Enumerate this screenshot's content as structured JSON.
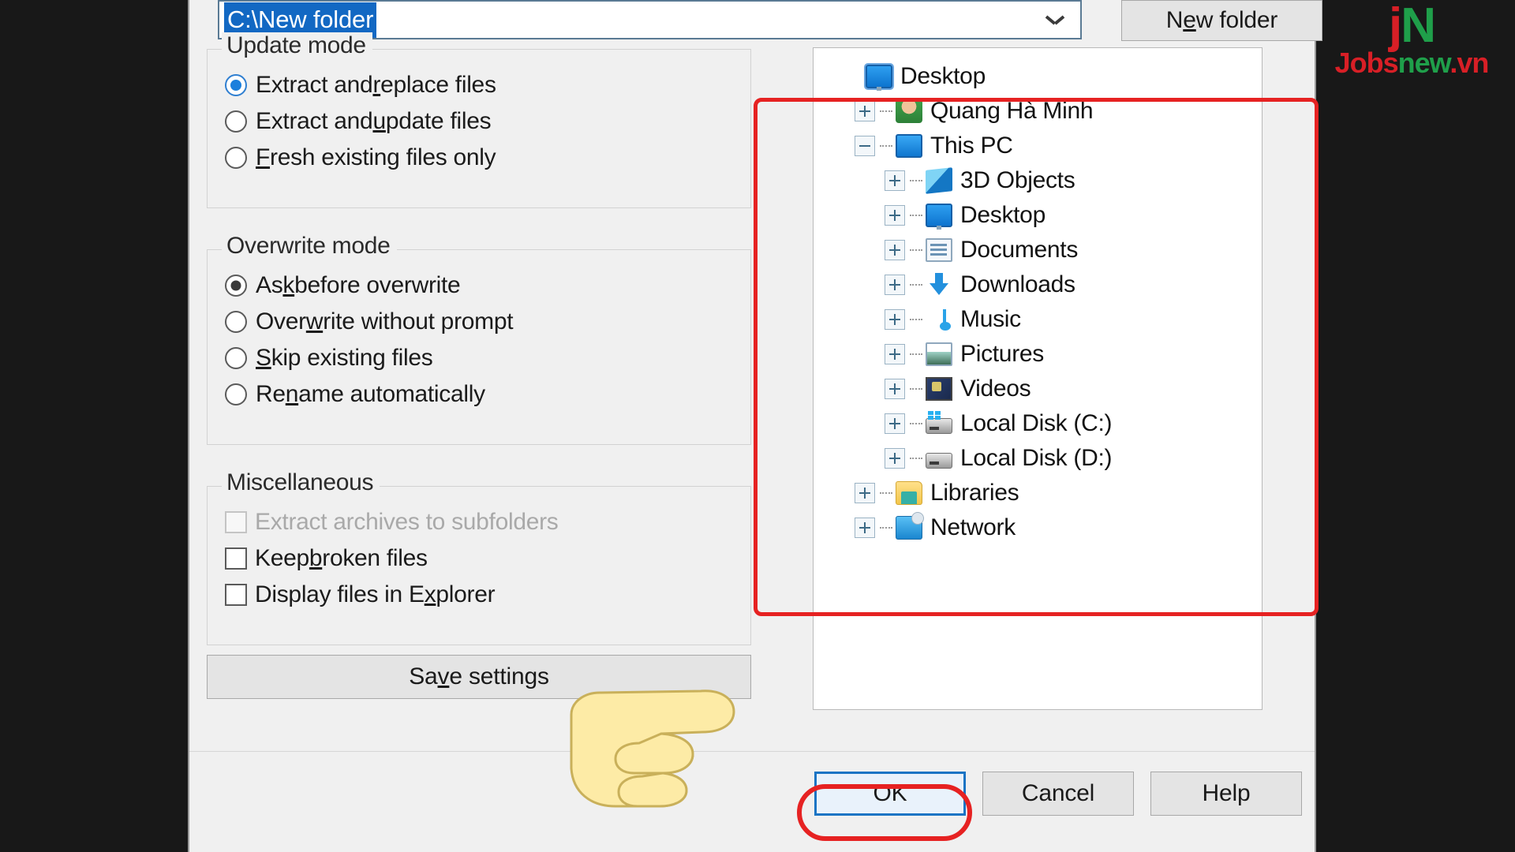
{
  "dialog": {
    "path_combo": {
      "value": "C:\\New folder",
      "dropdown_icon": "chevron-down-icon"
    },
    "new_folder_button": {
      "label_before": "N",
      "label_accel": "e",
      "label_after": "w folder"
    },
    "groups": [
      {
        "title": "Update mode",
        "options": [
          {
            "type": "radio",
            "state": "checked-blue",
            "before": "Extract and ",
            "accel": "r",
            "after": "eplace files"
          },
          {
            "type": "radio",
            "state": "unchecked",
            "before": "Extract and ",
            "accel": "u",
            "after": "pdate files"
          },
          {
            "type": "radio",
            "state": "unchecked",
            "before": "",
            "accel": "F",
            "after": "resh existing files only"
          }
        ]
      },
      {
        "title": "Overwrite mode",
        "options": [
          {
            "type": "radio",
            "state": "checked-dark",
            "before": "As",
            "accel": "k",
            "after": " before overwrite"
          },
          {
            "type": "radio",
            "state": "unchecked",
            "before": "Over",
            "accel": "w",
            "after": "rite without prompt"
          },
          {
            "type": "radio",
            "state": "unchecked",
            "before": "",
            "accel": "S",
            "after": "kip existing files"
          },
          {
            "type": "radio",
            "state": "unchecked",
            "before": "Re",
            "accel": "n",
            "after": "ame automatically"
          }
        ]
      },
      {
        "title": "Miscellaneous",
        "options": [
          {
            "type": "checkbox",
            "state": "disabled",
            "before": "Extract archives to subfolders",
            "accel": "",
            "after": ""
          },
          {
            "type": "checkbox",
            "state": "unchecked",
            "before": "Keep ",
            "accel": "b",
            "after": "roken files"
          },
          {
            "type": "checkbox",
            "state": "unchecked",
            "before": "Display files in E",
            "accel": "x",
            "after": "plorer"
          }
        ]
      }
    ],
    "save_settings_button": {
      "label_before": "Sa",
      "label_accel": "v",
      "label_after": "e settings"
    },
    "tree": {
      "items": [
        {
          "label": "Desktop",
          "indent": 0,
          "expander": "none",
          "icon": "monitor-icon",
          "selected": true
        },
        {
          "label": "Quang Hà Minh",
          "indent": 1,
          "expander": "plus",
          "icon": "user-icon",
          "selected": false
        },
        {
          "label": "This PC",
          "indent": 1,
          "expander": "minus",
          "icon": "pc-icon",
          "selected": false
        },
        {
          "label": "3D Objects",
          "indent": 2,
          "expander": "plus",
          "icon": "3d-cube-icon",
          "selected": false
        },
        {
          "label": "Desktop",
          "indent": 2,
          "expander": "plus",
          "icon": "monitor-icon",
          "selected": false
        },
        {
          "label": "Documents",
          "indent": 2,
          "expander": "plus",
          "icon": "document-icon",
          "selected": false
        },
        {
          "label": "Downloads",
          "indent": 2,
          "expander": "plus",
          "icon": "download-icon",
          "selected": false
        },
        {
          "label": "Music",
          "indent": 2,
          "expander": "plus",
          "icon": "music-note-icon",
          "selected": false
        },
        {
          "label": "Pictures",
          "indent": 2,
          "expander": "plus",
          "icon": "picture-icon",
          "selected": false
        },
        {
          "label": "Videos",
          "indent": 2,
          "expander": "plus",
          "icon": "video-icon",
          "selected": false
        },
        {
          "label": "Local Disk (C:)",
          "indent": 2,
          "expander": "plus",
          "icon": "system-drive-icon",
          "selected": false
        },
        {
          "label": "Local Disk (D:)",
          "indent": 2,
          "expander": "plus",
          "icon": "drive-icon",
          "selected": false
        },
        {
          "label": "Libraries",
          "indent": 1,
          "expander": "plus",
          "icon": "libraries-icon",
          "selected": false
        },
        {
          "label": "Network",
          "indent": 1,
          "expander": "plus",
          "icon": "network-icon",
          "selected": false
        }
      ]
    },
    "buttons": {
      "ok": "OK",
      "cancel": "Cancel",
      "help": "Help"
    }
  },
  "annotations": {
    "highlight_color": "#e62222",
    "ring_tree": "tree-panel-highlight",
    "ring_ok": "ok-button-highlight",
    "cursor": "pointing-hand-cursor"
  },
  "watermark": {
    "logo_j": "j",
    "logo_n": "N",
    "text_jobs": "Jobs",
    "text_new": "new",
    "text_vn": ".vn"
  }
}
